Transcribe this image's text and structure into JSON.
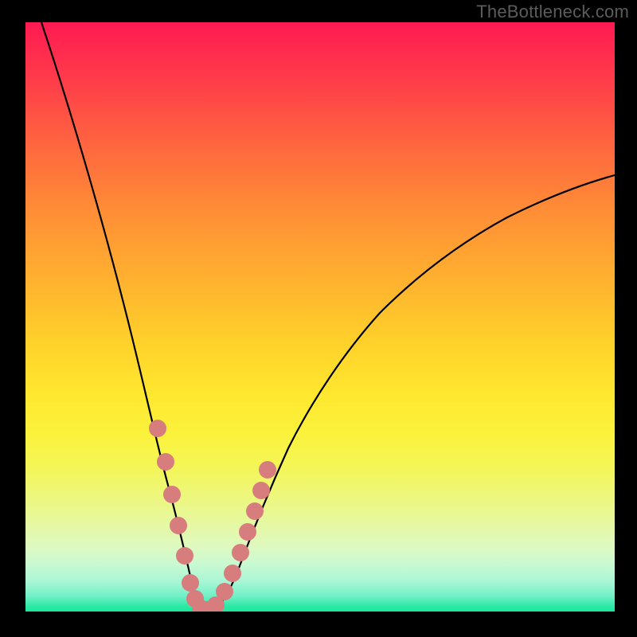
{
  "watermark": "TheBottleneck.com",
  "colors": {
    "background": "#000000",
    "gradient_top": "#ff1a52",
    "gradient_bottom": "#19e79c",
    "curve": "#000000",
    "marker": "#d77d7d"
  },
  "chart_data": {
    "type": "line",
    "title": "",
    "xlabel": "",
    "ylabel": "",
    "xlim": [
      0,
      1
    ],
    "ylim": [
      0,
      100
    ],
    "x": [
      0.0,
      0.05,
      0.1,
      0.15,
      0.18,
      0.2,
      0.22,
      0.24,
      0.26,
      0.28,
      0.3,
      0.32,
      0.35,
      0.4,
      0.45,
      0.5,
      0.55,
      0.6,
      0.65,
      0.7,
      0.75,
      0.8,
      0.85,
      0.9,
      0.95,
      1.0
    ],
    "values": [
      100,
      87,
      74,
      58,
      48,
      40,
      31,
      21,
      11,
      2,
      0,
      2,
      11,
      24,
      34,
      42,
      49,
      55,
      60,
      64,
      67,
      70,
      72,
      74,
      76,
      77
    ],
    "markers": {
      "x": [
        0.21,
        0.225,
        0.236,
        0.248,
        0.258,
        0.268,
        0.278,
        0.29,
        0.3,
        0.31,
        0.324,
        0.338,
        0.352,
        0.365,
        0.378,
        0.39,
        0.402
      ],
      "y": [
        35,
        28,
        22,
        16,
        10,
        5,
        2,
        0,
        0,
        1,
        4,
        8,
        12,
        16,
        20,
        24,
        27
      ]
    }
  }
}
